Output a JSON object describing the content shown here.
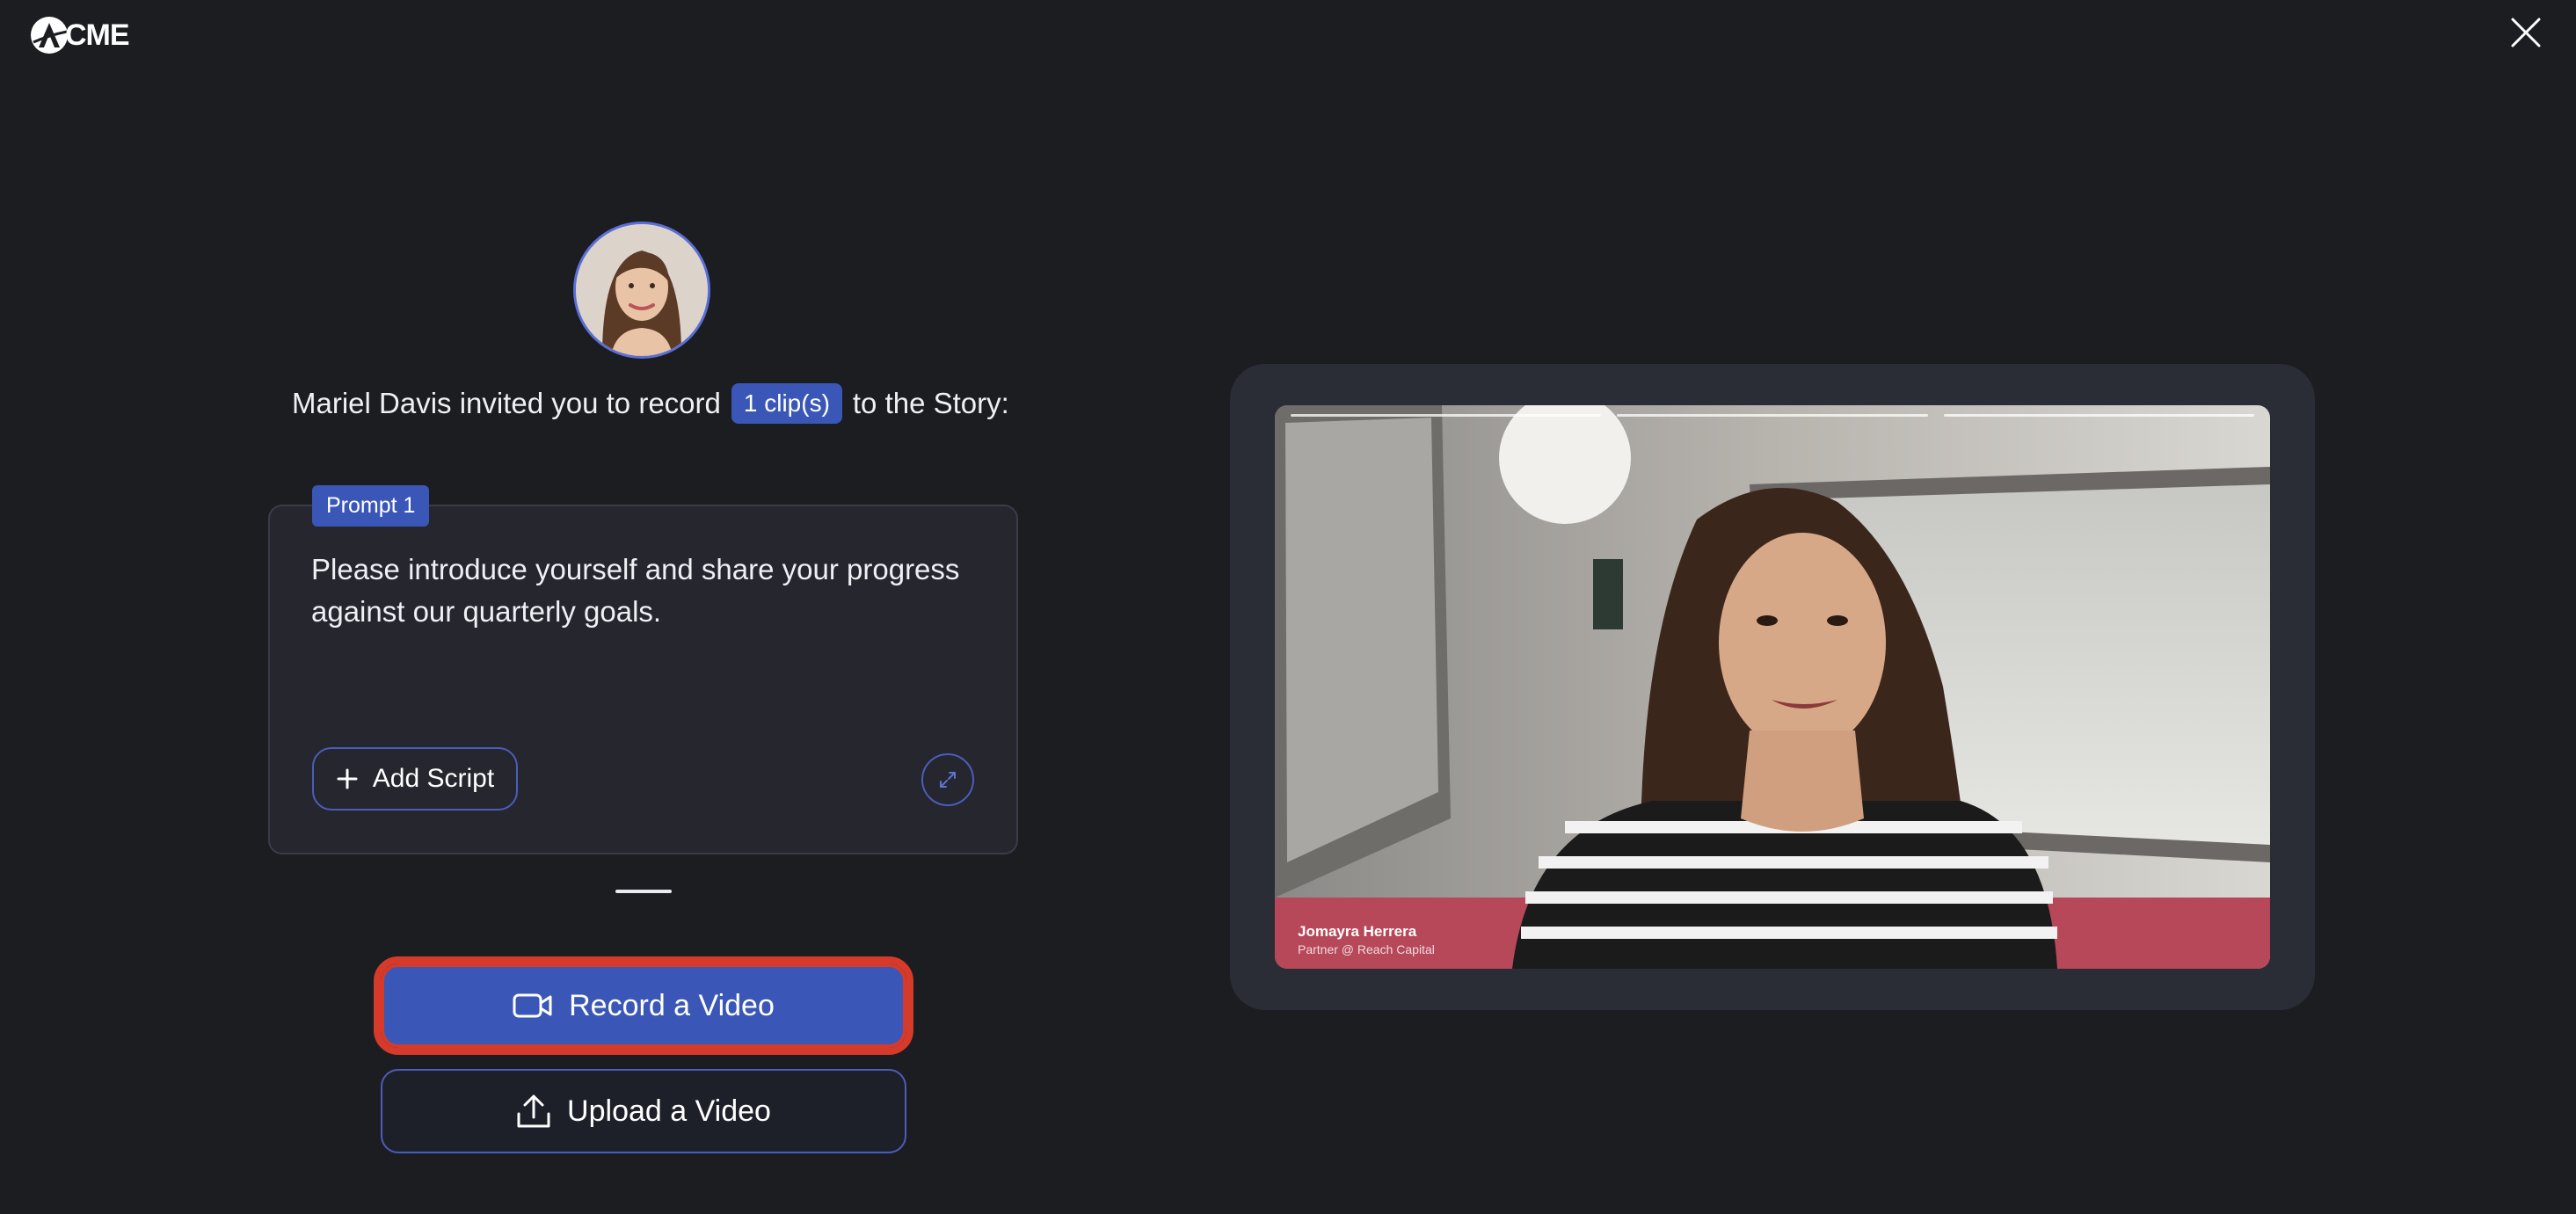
{
  "header": {
    "logo_text": "CME",
    "logo_icon": "acme-logo-icon",
    "close_icon": "close-icon"
  },
  "invite": {
    "inviter": "Mariel Davis invited you to record",
    "clip_count": "1 clip(s)",
    "suffix": "to the Story:"
  },
  "prompt": {
    "tag": "Prompt 1",
    "text": "Please introduce yourself and share your progress against our quarterly goals.",
    "add_script_label": "Add Script",
    "add_icon": "plus-icon",
    "expand_icon": "expand-icon"
  },
  "actions": {
    "record_label": "Record a Video",
    "record_icon": "video-camera-icon",
    "upload_label": "Upload a Video",
    "upload_icon": "upload-icon"
  },
  "preview": {
    "name": "Jomayra Herrera",
    "role": "Partner @ Reach Capital"
  },
  "colors": {
    "background": "#1c1d21",
    "accent": "#3a57b8",
    "highlight": "#d53a2a",
    "card": "#25262e"
  }
}
